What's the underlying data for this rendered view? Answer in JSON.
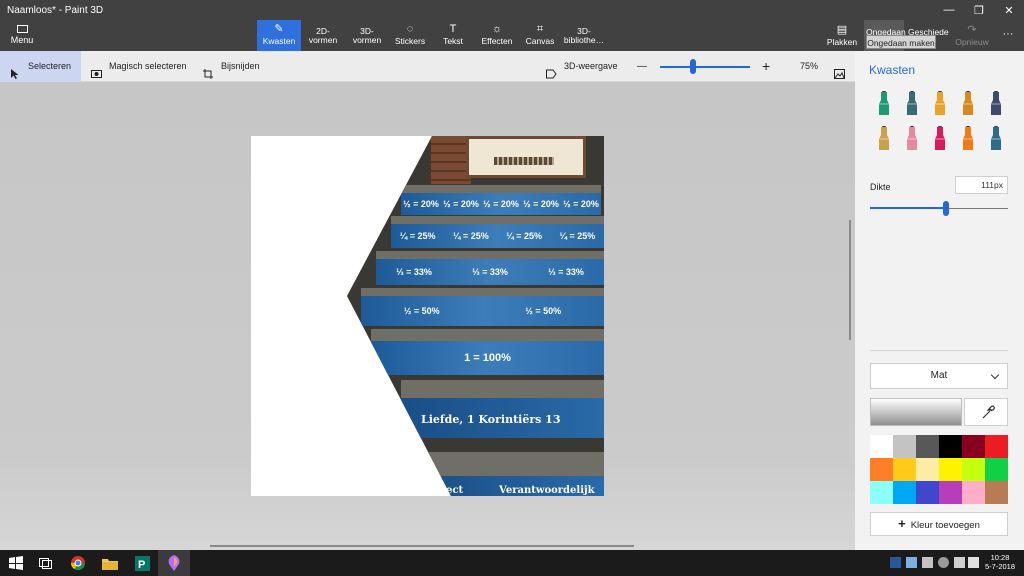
{
  "window": {
    "title": "Naamloos* - Paint 3D",
    "controls": [
      "—",
      "❐",
      "✕"
    ]
  },
  "ribbon": {
    "menu_label": "Menu",
    "tools": [
      {
        "label1": "Kwasten",
        "label2": "",
        "icon": "brush-icon"
      },
      {
        "label1": "2D-",
        "label2": "vormen",
        "icon": "2d-shapes-icon"
      },
      {
        "label1": "3D-",
        "label2": "vormen",
        "icon": "3d-shapes-icon"
      },
      {
        "label1": "Stickers",
        "label2": "",
        "icon": "stickers-icon"
      },
      {
        "label1": "Tekst",
        "label2": "",
        "icon": "text-icon"
      },
      {
        "label1": "Effecten",
        "label2": "",
        "icon": "effects-icon"
      },
      {
        "label1": "Canvas",
        "label2": "",
        "icon": "canvas-icon"
      },
      {
        "label1": "3D-",
        "label2": "bibliothe…",
        "icon": "3d-library-icon"
      }
    ],
    "active_tool": "Kwasten",
    "paste_label": "Plakken",
    "undo_label": "Ongedaan",
    "history_label": "Geschiede",
    "redo_label": "Opnieuw",
    "undo_tooltip": "Ongedaan maken"
  },
  "toolbar": {
    "select_label": "Selecteren",
    "magic_select_label": "Magisch selecteren",
    "crop_label": "Bijsnijden",
    "view3d_label": "3D-weergave",
    "zoom_minus": "—",
    "zoom_plus": "+",
    "zoom_level": "75%",
    "zoom_fraction": 0.35
  },
  "canvas_image": {
    "risers": [
      {
        "labels": [
          "½ = 20%",
          "½ = 20%",
          "½ = 20%",
          "½ = 20%",
          "½ = 20%"
        ]
      },
      {
        "labels": [
          "¼ = 25%",
          "¼ = 25%",
          "¼ = 25%",
          "¼ = 25%"
        ]
      },
      {
        "labels": [
          "⅓ = 33%",
          "⅓ = 33%",
          "⅓ = 33%"
        ]
      },
      {
        "labels": [
          "½ = 50%",
          "½ = 50%"
        ]
      },
      {
        "labels": [
          "1 = 100%"
        ]
      }
    ],
    "text_liefde": "Liefde, 1 Korintiërs 13",
    "text_bottom_left": "ect",
    "text_bottom_right": "Verantwoordelijk"
  },
  "panel": {
    "title": "Kwasten",
    "brushes": [
      {
        "name": "marker-icon",
        "color": "#1f9a74"
      },
      {
        "name": "calligraphy-pen-icon",
        "color": "#3b6a72"
      },
      {
        "name": "oil-brush-icon",
        "color": "#e8a42a"
      },
      {
        "name": "watercolor-icon",
        "color": "#d98a1f"
      },
      {
        "name": "pixel-pen-icon",
        "color": "#3d4a6b"
      },
      {
        "name": "pencil-icon",
        "color": "#caa24a"
      },
      {
        "name": "eraser-icon",
        "color": "#e58aa0"
      },
      {
        "name": "crayon-icon",
        "color": "#d81b5d"
      },
      {
        "name": "spraycan-icon",
        "color": "#f07a17"
      },
      {
        "name": "fill-bucket-icon",
        "color": "#2c6c8a"
      }
    ],
    "thickness_label": "Dikte",
    "thickness_value": "111px",
    "thickness_fraction": 0.55,
    "finish_value": "Mat",
    "add_color_label": "Kleur toevoegen",
    "palette": [
      "#ffffff",
      "#c3c3c3",
      "#585858",
      "#000000",
      "#88001b",
      "#ec1c24",
      "#ff7f27",
      "#ffca18",
      "#fdeca6",
      "#fff200",
      "#c4ff0e",
      "#0ed145",
      "#8cfffb",
      "#00a8f3",
      "#3f48cc",
      "#b83dba",
      "#ffaec8",
      "#b97a56"
    ]
  },
  "taskbar": {
    "time": "10:28",
    "date": "5-7-2018"
  }
}
